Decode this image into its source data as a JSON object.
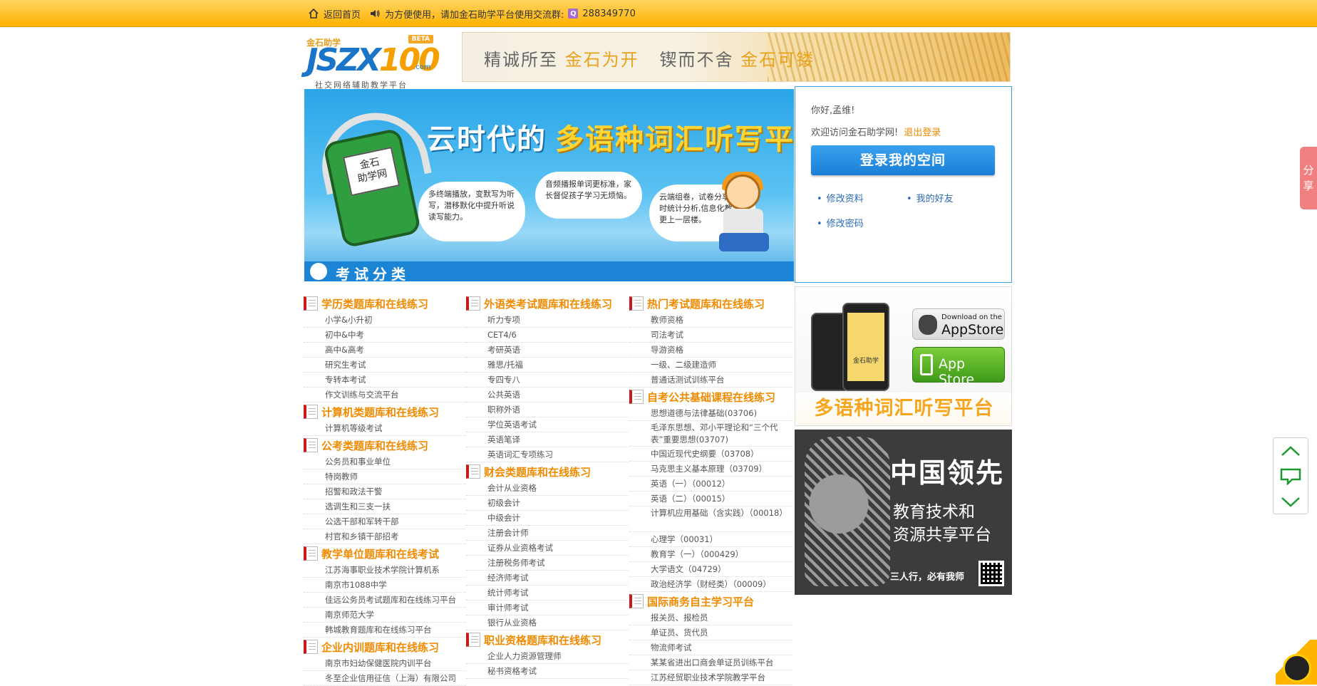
{
  "topbar": {
    "home": "返回首页",
    "notice": "为方便使用，请加金石助学平台使用交流群:",
    "qq_group": "288349770"
  },
  "logo": {
    "cn": "金石助学",
    "brand_a": "JSZX",
    "brand_b": "100",
    "domain": ".com",
    "beta": "BETA",
    "tagline": "社交网络辅助教学平台"
  },
  "top_banner": {
    "s1": "精诚所至",
    "s2": "金石为开",
    "s3": "锲而不舍",
    "s4": "金石可镂"
  },
  "main_banner": {
    "title_white": "云时代的",
    "title_gold": "多语种词汇听写平台",
    "player_label": "金石\n助学网",
    "cloud1": "多终端播放，变默写为听写，潜移默化中提升听说读写能力。",
    "cloud2": "音频播报单词更标准，家长督促孩子学习无烦恼。",
    "cloud3": "云端组卷，试卷分享，即时统计分析,信息化教学更上一层楼。",
    "section_label": "考试分类"
  },
  "login": {
    "hello": "你好,孟维!",
    "welcome": "欢迎访问金石助学网!",
    "logout": "退出登录",
    "space_button": "登录我的空间",
    "links": [
      "修改资料",
      "我的好友",
      "修改密码"
    ]
  },
  "columns": [
    {
      "sections": [
        {
          "title": "学历类题库和在线练习",
          "items": [
            "小学&小升初",
            "初中&中考",
            "高中&高考",
            "研究生考试",
            "专转本考试",
            "作文训练与交流平台"
          ]
        },
        {
          "title": "计算机类题库和在线练习",
          "items": [
            "计算机等级考试"
          ]
        },
        {
          "title": "公考类题库和在线练习",
          "items": [
            "公务员和事业单位",
            "特岗教师",
            "招警和政法干警",
            "选调生和三支一扶",
            "公选干部和军转干部",
            "村官和乡镇干部招考"
          ]
        },
        {
          "title": "教学单位题库和在线考试",
          "items": [
            "江苏海事职业技术学院计算机系",
            "南京市1088中学",
            "佳远公务员考试题库和在线练习平台",
            "南京师范大学",
            "韩城教育题库和在线练习平台"
          ]
        },
        {
          "title": "企业内训题库和在线练习",
          "items": [
            "南京市妇幼保健医院内训平台",
            "冬至企业信用征信（上海）有限公司"
          ]
        }
      ]
    },
    {
      "sections": [
        {
          "title": "外语类考试题库和在线练习",
          "items": [
            "听力专项",
            "CET4/6",
            "考研英语",
            "雅思/托福",
            "专四专八",
            "公共英语",
            "职称外语",
            "学位英语考试",
            "英语笔译",
            "英语词汇专项练习"
          ]
        },
        {
          "title": "财会类题库和在线练习",
          "items": [
            "会计从业资格",
            "初级会计",
            "中级会计",
            "注册会计师",
            "证券从业资格考试",
            "注册税务师考试",
            "经济师考试",
            "统计师考试",
            "审计师考试",
            "银行从业资格"
          ]
        },
        {
          "title": "职业资格题库和在线练习",
          "items": [
            "企业人力资源管理师",
            "秘书资格考试"
          ]
        }
      ]
    },
    {
      "sections": [
        {
          "title": "热门考试题库和在线练习",
          "items": [
            "教师资格",
            "司法考试",
            "导游资格",
            "一级、二级建造师",
            "普通话测试训练平台"
          ]
        },
        {
          "title": "自考公共基础课程在线练习",
          "items": [
            "思想道德与法律基础(03706)",
            "毛泽东思想、邓小平理论和“三个代表”重要思想(03707)",
            "中国近现代史纲要（03708）",
            "马克思主义基本原理（03709）",
            "英语（一）（00012）",
            "英语（二）（00015）",
            "计算机应用基础（含实践）（00018）",
            "心理学（00031）",
            "教育学（一）（000429）",
            "大学语文（04729）",
            "政治经济学（财经类）（00009）"
          ]
        },
        {
          "title": "国际商务自主学习平台",
          "items": [
            "报关员、报检员",
            "单证员、货代员",
            "物流师考试",
            "某某省进出口商会单证员训练平台",
            "江苏经贸职业技术学院教学平台"
          ]
        }
      ]
    }
  ],
  "ad_app": {
    "download_on": "Download on the",
    "appstore_dark": "AppStore",
    "appstore_green": "App Store",
    "phone_label": "金石助学",
    "strapline": "多语种词汇听写平台"
  },
  "ad_edu": {
    "calligraphy": "中国领先",
    "line1": "教育技术和",
    "line2": "资源共享平台",
    "motto": "三人行，必有我师"
  },
  "share": {
    "label": "分享"
  }
}
